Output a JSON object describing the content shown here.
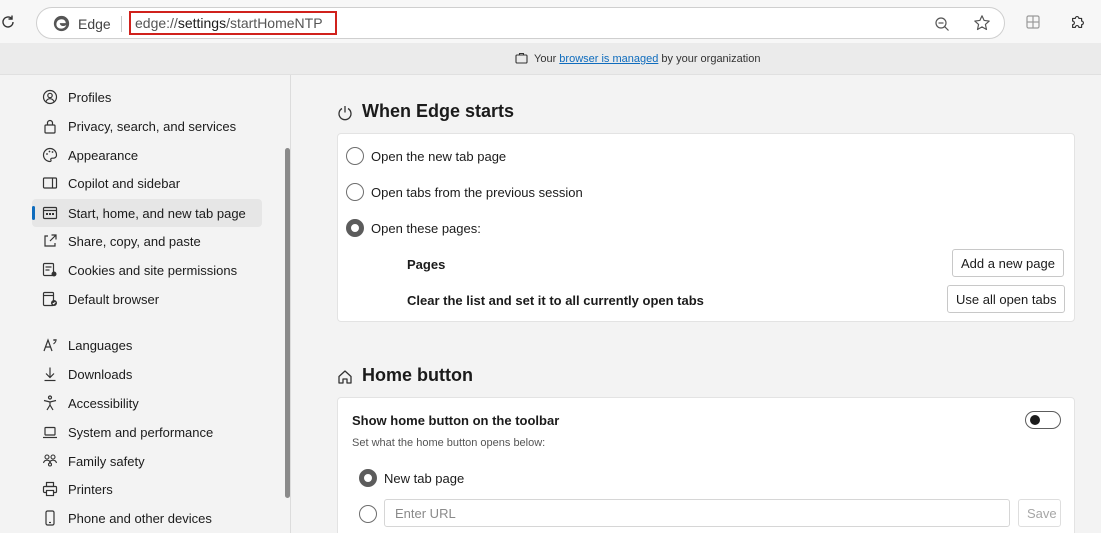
{
  "browser": {
    "name": "Edge",
    "url_scheme": "edge://",
    "url_host": "settings",
    "url_path": "/startHomeNTP"
  },
  "managed_bar": {
    "prefix": "Your ",
    "link": "browser is managed",
    "suffix": " by your organization"
  },
  "sidebar": {
    "items": [
      {
        "label": "Profiles",
        "icon": "profile-icon"
      },
      {
        "label": "Privacy, search, and services",
        "icon": "lock-icon"
      },
      {
        "label": "Appearance",
        "icon": "palette-icon"
      },
      {
        "label": "Copilot and sidebar",
        "icon": "sidebar-icon"
      },
      {
        "label": "Start, home, and new tab page",
        "icon": "start-page-icon",
        "active": true
      },
      {
        "label": "Share, copy, and paste",
        "icon": "share-icon"
      },
      {
        "label": "Cookies and site permissions",
        "icon": "cookies-icon"
      },
      {
        "label": "Default browser",
        "icon": "default-browser-icon"
      },
      {
        "label": "Languages",
        "icon": "language-icon"
      },
      {
        "label": "Downloads",
        "icon": "download-icon"
      },
      {
        "label": "Accessibility",
        "icon": "accessibility-icon"
      },
      {
        "label": "System and performance",
        "icon": "laptop-icon"
      },
      {
        "label": "Family safety",
        "icon": "family-icon"
      },
      {
        "label": "Printers",
        "icon": "printer-icon"
      },
      {
        "label": "Phone and other devices",
        "icon": "phone-icon"
      }
    ]
  },
  "startup": {
    "title": "When Edge starts",
    "options": [
      {
        "label": "Open the new tab page",
        "checked": false
      },
      {
        "label": "Open tabs from the previous session",
        "checked": false
      },
      {
        "label": "Open these pages:",
        "checked": true
      }
    ],
    "pages_label": "Pages",
    "add_page_button": "Add a new page",
    "clear_label": "Clear the list and set it to all currently open tabs",
    "use_open_tabs_button": "Use all open tabs"
  },
  "home": {
    "title": "Home button",
    "show_label": "Show home button on the toolbar",
    "show_toggle_on": false,
    "sub_label": "Set what the home button opens below:",
    "options": [
      {
        "label": "New tab page",
        "checked": true
      }
    ],
    "url_placeholder": "Enter URL",
    "save_button": "Save"
  },
  "colors": {
    "accent": "#0f6cbd",
    "url_highlight": "#d0211c"
  }
}
